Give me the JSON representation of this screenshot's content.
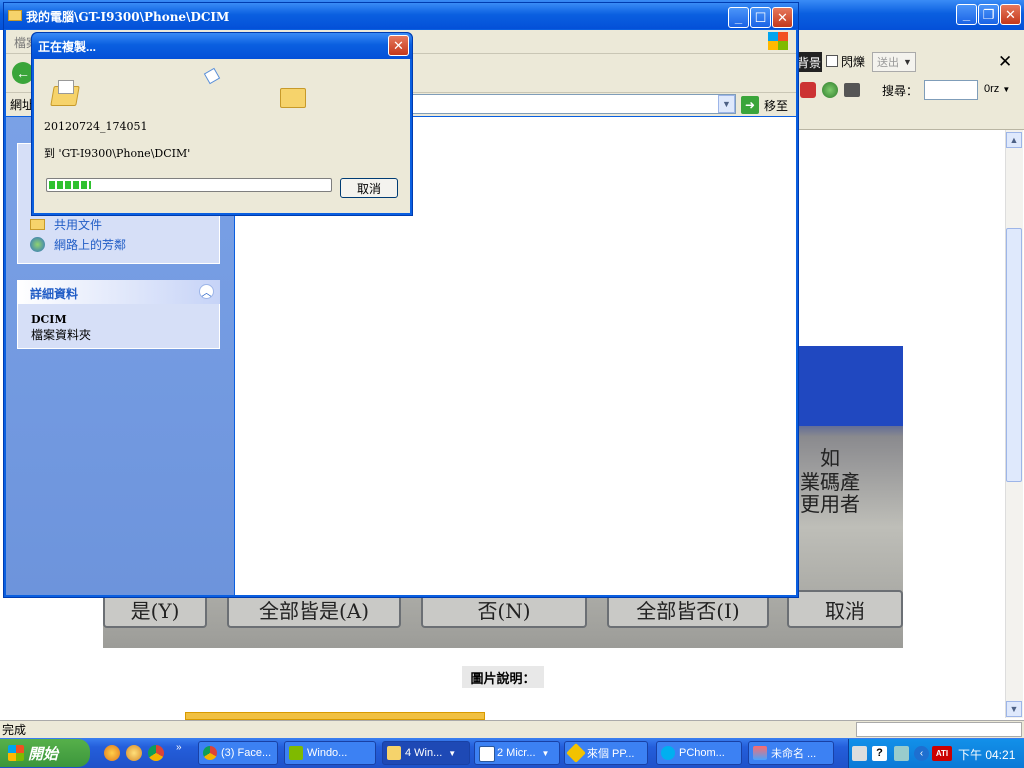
{
  "background_window": {
    "toolbar": {
      "partial_button": "背景",
      "checkbox_label": "閃爍",
      "send_label": "送出",
      "search_label": "搜尋：",
      "dropdown_value": "0rz"
    },
    "caption": "圖片說明：",
    "photo_text": {
      "line1": "如",
      "line2": "業碼產",
      "line3": "更用者",
      "buttons": [
        "是(Y)",
        "全部皆是(A)",
        "否(N)",
        "全部皆否(I)",
        "取消"
      ]
    },
    "status": "完成"
  },
  "explorer": {
    "title": "我的電腦\\GT-I9300\\Phone\\DCIM",
    "menu_partial": "檔案",
    "address_label": "網址",
    "go_label": "移至",
    "other_places": [
      "共用文件",
      "網路上的芳鄰"
    ],
    "details": {
      "header": "詳細資料",
      "name": "DCIM",
      "type": "檔案資料夾"
    }
  },
  "copy_dialog": {
    "title": "正在複製...",
    "filename": "20120724_174051",
    "destination": "到 'GT-I9300\\Phone\\DCIM'",
    "progress_percent": 15,
    "cancel_label": "取消"
  },
  "taskbar": {
    "start_label": "開始",
    "items": [
      {
        "label": "(3) Face..."
      },
      {
        "label": "Windo..."
      },
      {
        "label": "4 Win..."
      },
      {
        "label": "2 Micr..."
      },
      {
        "label": "來個 PP..."
      },
      {
        "label": "PChom..."
      },
      {
        "label": "未命名 ..."
      }
    ],
    "clock": "下午 04:21"
  }
}
